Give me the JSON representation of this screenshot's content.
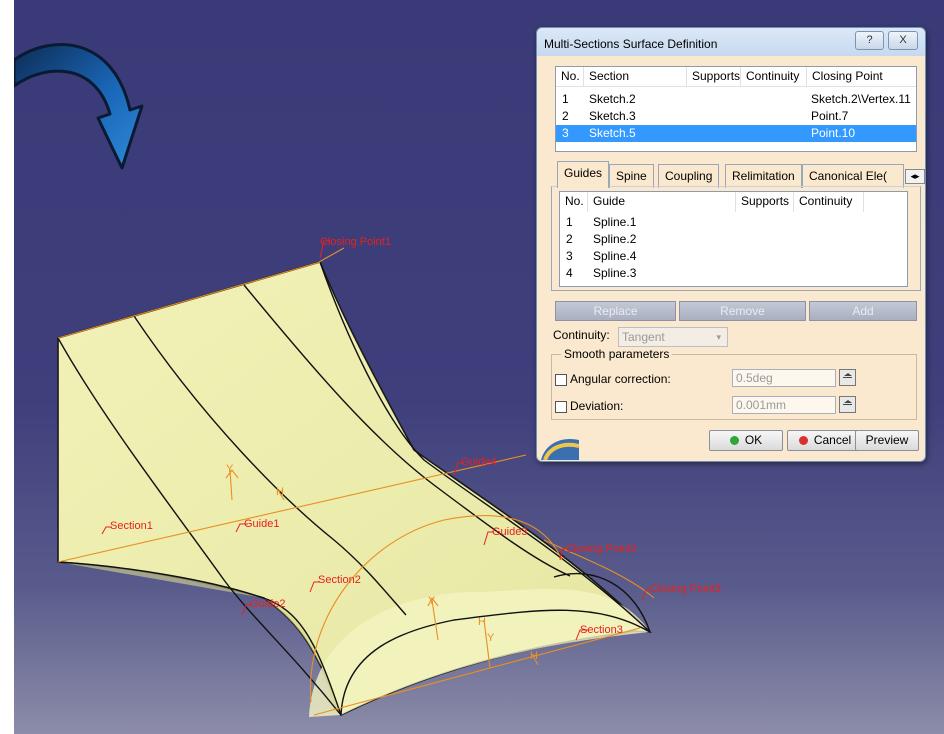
{
  "dialog": {
    "title": "Multi-Sections Surface Definition",
    "help_label": "?",
    "close_label": "X",
    "sections_table": {
      "headers": [
        "No.",
        "Section",
        "Supports",
        "Continuity",
        "Closing Point"
      ],
      "rows": [
        {
          "no": "1",
          "section": "Sketch.2",
          "closing": "Sketch.2\\Vertex.11"
        },
        {
          "no": "2",
          "section": "Sketch.3",
          "closing": "Point.7"
        },
        {
          "no": "3",
          "section": "Sketch.5",
          "closing": "Point.10"
        }
      ]
    },
    "tabs": [
      "Guides",
      "Spine",
      "Coupling",
      "Relimitation",
      "Canonical Ele("
    ],
    "guides_table": {
      "headers": [
        "No.",
        "Guide",
        "Supports",
        "Continuity"
      ],
      "rows": [
        {
          "no": "1",
          "guide": "Spline.1"
        },
        {
          "no": "2",
          "guide": "Spline.2"
        },
        {
          "no": "3",
          "guide": "Spline.4"
        },
        {
          "no": "4",
          "guide": "Spline.3"
        }
      ]
    },
    "buttons": {
      "replace": "Replace",
      "remove": "Remove",
      "add": "Add"
    },
    "continuity_label": "Continuity:",
    "continuity_value": "Tangent",
    "smooth_group": "Smooth parameters",
    "angular_label": "Angular correction:",
    "angular_value": "0.5deg",
    "deviation_label": "Deviation:",
    "deviation_value": "0.001mm",
    "ok": "OK",
    "cancel": "Cancel",
    "preview": "Preview"
  },
  "labels": {
    "closing_point1": "Closing Point1",
    "closing_point2": "Closing Point2",
    "closing_point3": "Closing Point3",
    "section1": "Section1",
    "section2": "Section2",
    "section3": "Section3",
    "guide1": "Guide1",
    "guide2": "Guide2",
    "guide3": "Guide3",
    "guide4": "Guide4",
    "axis_y": "Y",
    "axis_h": "H"
  },
  "colors": {
    "surface": "#efefae",
    "edge": "#141414",
    "annotation": "#e8211d",
    "orange_curve": "#e89020",
    "arrow": "#1f73bf"
  }
}
